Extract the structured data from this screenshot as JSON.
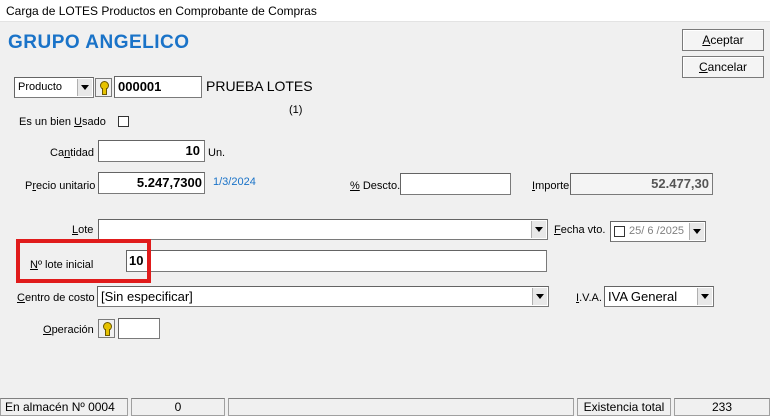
{
  "window": {
    "title": "Carga de LOTES Productos en Comprobante de Compras"
  },
  "company": {
    "name": "GRUPO ANGELICO"
  },
  "colors": {
    "brand": "#1a73c8",
    "date": "#1a73c8",
    "highlight": "#e01b1b"
  },
  "buttons": {
    "accept": {
      "u": "A",
      "rest": "ceptar"
    },
    "cancel": {
      "u": "C",
      "rest": "ancelar"
    }
  },
  "product": {
    "type_value": "Producto",
    "code": "000001",
    "name": "PRUEBA LOTES",
    "count_note": "(1)"
  },
  "used_good": {
    "pre": "Es un bien ",
    "u": "U",
    "post": "sado",
    "checked": false
  },
  "quantity": {
    "pre": "Ca",
    "u": "n",
    "post": "tidad",
    "value": "10",
    "unit": "Un."
  },
  "unit_price": {
    "pre": "P",
    "u": "r",
    "post": "ecio unitario",
    "value": "5.247,7300",
    "date": "1/3/2024"
  },
  "discount": {
    "pre": "",
    "u": "%",
    "post": " Descto.",
    "value": ""
  },
  "amount": {
    "pre": "",
    "u": "I",
    "post": "mporte",
    "value": "52.477,30"
  },
  "lot": {
    "pre": "",
    "u": "L",
    "post": "ote",
    "value": ""
  },
  "expiry": {
    "pre": "",
    "u": "F",
    "post": "echa vto.",
    "value": "25/ 6 /2025",
    "checked": false
  },
  "initial_lot": {
    "pre": "",
    "u": "N",
    "post": "º lote inicial",
    "value": "10"
  },
  "cost_center": {
    "pre": "",
    "u": "C",
    "post": "entro de costo",
    "value": "[Sin especificar]"
  },
  "iva": {
    "pre": "",
    "u": "I",
    "post": ".V.A.",
    "value": "IVA General"
  },
  "operation": {
    "pre": "",
    "u": "O",
    "post": "peración",
    "value": ""
  },
  "status": {
    "warehouse_label": "En almacén Nº 0004",
    "warehouse_value": "0",
    "stock_label": "Existencia total",
    "stock_value": "233"
  }
}
